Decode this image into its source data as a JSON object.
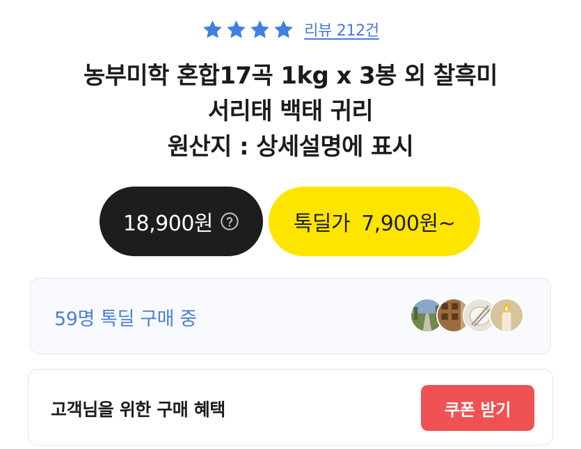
{
  "rating": {
    "stars": 4,
    "star_color": "#3f7fe0",
    "review_link": "리뷰 212건"
  },
  "product": {
    "title_line1": "농부미학 혼합17곡 1kg x 3봉 외 찰흑미",
    "title_line2": "서리태 백태 귀리",
    "title_line3": "원산지 : 상세설명에 표시"
  },
  "price": {
    "normal_price": "18,900원",
    "normal_icon": "question-circle-icon",
    "deal_label": "톡딜가",
    "deal_price": "7,900원~",
    "deal_color": "#fee500"
  },
  "buyers": {
    "text": "59명 톡딜 구매 중",
    "avatars": [
      "road-photo",
      "building-photo",
      "tableware-photo",
      "candle-photo"
    ]
  },
  "benefit": {
    "text": "고객님을 위한 구매 혜택",
    "coupon_button": "쿠폰 받기",
    "button_color": "#f05152"
  }
}
